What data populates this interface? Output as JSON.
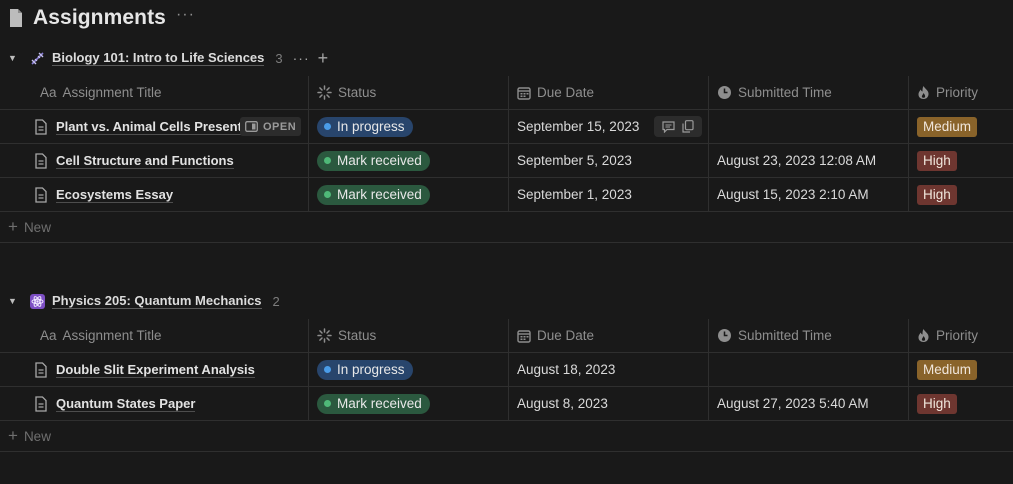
{
  "page": {
    "title": "Assignments",
    "more": "···"
  },
  "columns": {
    "title": "Assignment Title",
    "title_prefix": "Aa",
    "status": "Status",
    "due": "Due Date",
    "submitted": "Submitted Time",
    "priority": "Priority"
  },
  "groups": [
    {
      "title": "Biology 101: Intro to Life Sciences",
      "count": "3",
      "more": "···",
      "add": "+",
      "rows": [
        {
          "title": "Plant vs. Animal Cells Presentation",
          "status": "In progress",
          "due": "September 15, 2023",
          "submitted": "",
          "priority": "Medium",
          "open_label": "OPEN"
        },
        {
          "title": "Cell Structure and Functions",
          "status": "Mark received",
          "due": "September 5, 2023",
          "submitted": "August 23, 2023 12:08 AM",
          "priority": "High"
        },
        {
          "title": "Ecosystems Essay",
          "status": "Mark received",
          "due": "September 1, 2023",
          "submitted": "August 15, 2023 2:10 AM",
          "priority": "High"
        }
      ],
      "new_label": "New"
    },
    {
      "title": "Physics 205: Quantum Mechanics",
      "count": "2",
      "rows": [
        {
          "title": "Double Slit Experiment Analysis",
          "status": "In progress",
          "due": "August 18, 2023",
          "submitted": "",
          "priority": "Medium"
        },
        {
          "title": "Quantum States Paper",
          "status": "Mark received",
          "due": "August 8, 2023",
          "submitted": "August 27, 2023 5:40 AM",
          "priority": "High"
        }
      ],
      "new_label": "New"
    }
  ],
  "icons": {
    "page": "document-icon",
    "biology": "dna-icon",
    "physics": "atom-icon",
    "status_col": "status-spinner-icon",
    "due_col": "calendar-icon",
    "submitted_col": "clock-icon",
    "priority_col": "flame-icon"
  },
  "colors": {
    "in_progress": "#28456c",
    "mark_received": "#2b593f",
    "medium": "#89632a",
    "high": "#6e3630"
  }
}
